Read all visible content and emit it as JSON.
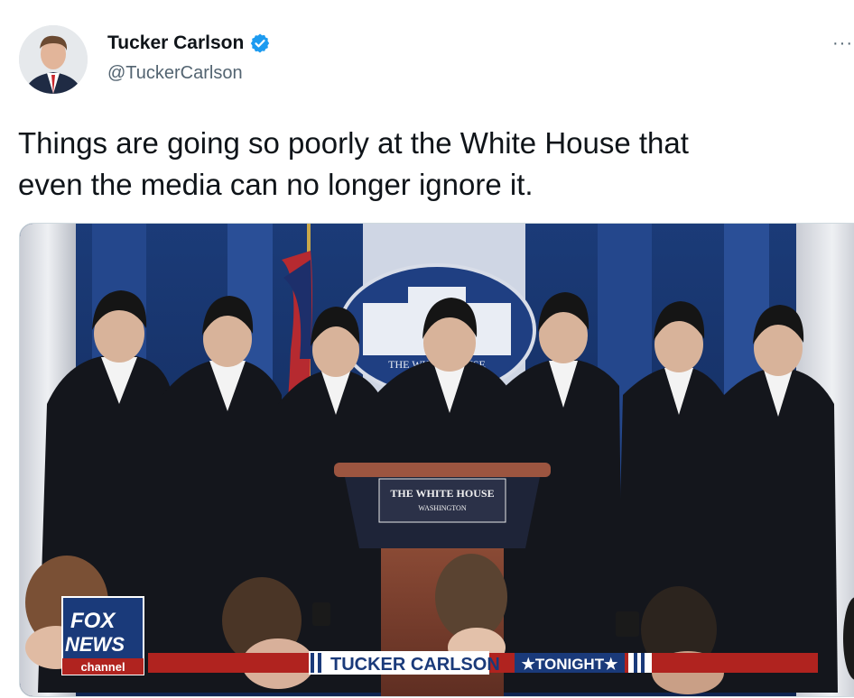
{
  "author": {
    "name": "Tucker Carlson",
    "handle": "@TuckerCarlson",
    "verified_icon": "verified-badge-icon",
    "verified_color": "#1d9bf0"
  },
  "more_label": "···",
  "tweet": {
    "text": "Things are going so poorly at the White House that\neven the media can no longer ignore it."
  },
  "media": {
    "seal_text": "THE WHITE HOUSE",
    "podium_sign_line1": "THE WHITE HOUSE",
    "podium_sign_line2": "WASHINGTON",
    "network_logo_line1": "FOX",
    "network_logo_line2": "NEWS",
    "network_logo_line3": "channel",
    "lower_third_show": "TUCKER CARLSON",
    "lower_third_tag": "★TONIGHT★",
    "lower_third_color": "#b0231f",
    "brand_blue": "#1a3a7a"
  }
}
